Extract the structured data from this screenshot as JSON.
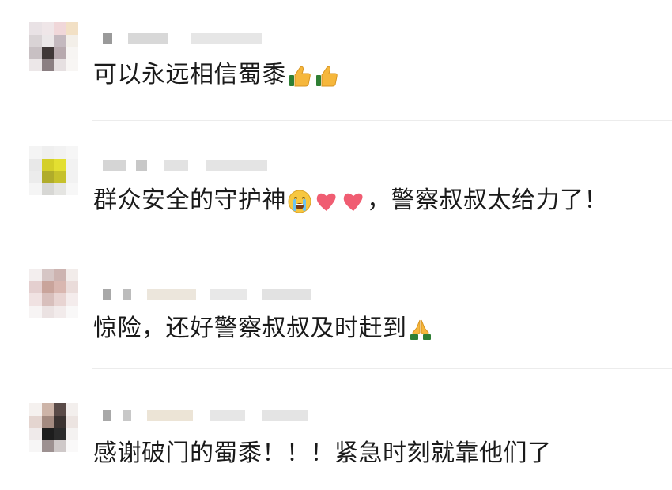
{
  "comments": [
    {
      "text": "可以永远相信蜀黍",
      "emojis": [
        "thumbs-up-icon",
        "thumbs-up-icon"
      ],
      "avatar_colors": [
        "#e9e2e5",
        "#efe6e8",
        "#f0d7d9",
        "#f2e0c5",
        "#d9d3d5",
        "#ebe7e8",
        "#c4b9bf",
        "#f3efe9",
        "#c8c0c3",
        "#3f3737",
        "#b7a9ae",
        "#f7f5f3",
        "#ece7e8",
        "#8b7f82",
        "#e6e0e1",
        "#f8f6f4"
      ]
    },
    {
      "text_before": "群众安全的守护神",
      "emojis": [
        "loudly-crying-face-icon",
        "red-heart-icon",
        "red-heart-icon"
      ],
      "text_after": "，警察叔叔太给力了！",
      "avatar_colors": [
        "#f4f4f4",
        "#efefef",
        "#f2f2f2",
        "#f6f6f6",
        "#e8e8e8",
        "#d4cf28",
        "#e3df31",
        "#f2f2f2",
        "#ececec",
        "#b0ac2a",
        "#c6c12b",
        "#f2f2f2",
        "#f5f5f5",
        "#d7d7d4",
        "#e5e5e2",
        "#f7f7f7"
      ]
    },
    {
      "text": "惊险，还好警察叔叔及时赶到",
      "emojis": [
        "folded-hands-icon"
      ],
      "avatar_colors": [
        "#f3eeee",
        "#d6c6c5",
        "#cdb4b1",
        "#f2ecea",
        "#e4cfcf",
        "#c9a49b",
        "#d9b7b0",
        "#eadcda",
        "#f0e2e2",
        "#d8bfbc",
        "#e8d4d2",
        "#f4ecec",
        "#f7f4f4",
        "#ebe2e2",
        "#f2ebeb",
        "#f9f8f8"
      ]
    },
    {
      "text": "感谢破门的蜀黍！！！紧急时刻就靠他们了",
      "emojis": [],
      "avatar_colors": [
        "#f5f1ef",
        "#cdb4a8",
        "#5a4b48",
        "#f3efed",
        "#e4d5d0",
        "#a38a80",
        "#3b3331",
        "#ece4e1",
        "#efeaea",
        "#1d1d1d",
        "#2b2b2b",
        "#f4f2f1",
        "#f7f6f6",
        "#9d9191",
        "#cfc9c9",
        "#faf9f9"
      ]
    }
  ],
  "colors": {
    "text": "#1a1a1a",
    "meta_blur": "#d9d9d9",
    "separator": "#ececec"
  }
}
